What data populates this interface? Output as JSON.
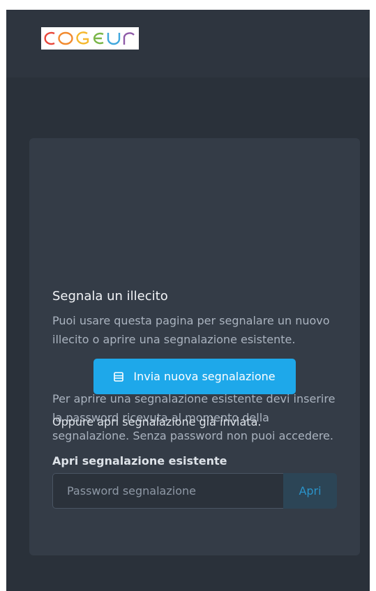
{
  "header": {
    "logo_text": "COGEUR"
  },
  "card": {
    "title": "Segnala un illecito",
    "intro": "Puoi usare questa pagina per segnalare un nuovo illecito o aprire una segnalazione esistente.",
    "password_info": "Per aprire una segnalazione esistente devi inserire la password ricevuta al momento della segnalazione. Senza password non puoi accedere.",
    "new_report_button": "Invia nuova segnalazione",
    "new_report_icon": "form-icon",
    "alternative_text": "Oppure apri segnalazione già inviata.",
    "open_existing": {
      "label": "Apri segnalazione esistente",
      "placeholder": "Password segnalazione",
      "value": "",
      "button": "Apri"
    }
  },
  "colors": {
    "page_background": "#2a313a",
    "card_background": "#343c47",
    "primary_button": "#1ea8ea",
    "secondary_button": "#2c4556",
    "secondary_button_text": "#2a93c9"
  }
}
